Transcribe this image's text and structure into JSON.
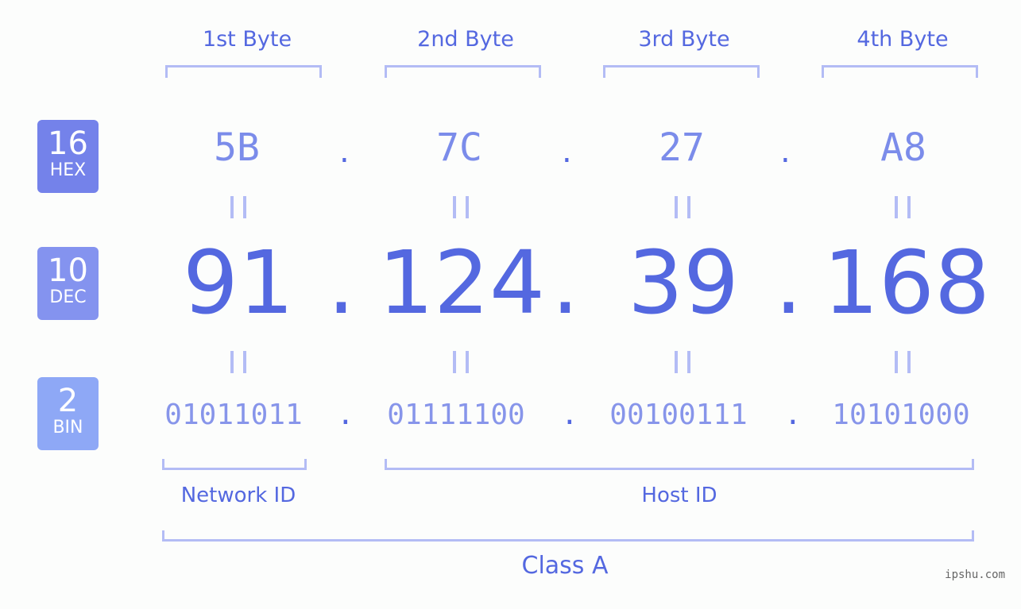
{
  "bytes": [
    {
      "label": "1st Byte",
      "hex": "5B",
      "dec": "91",
      "bin": "01011011"
    },
    {
      "label": "2nd Byte",
      "hex": "7C",
      "dec": "124",
      "bin": "01111100"
    },
    {
      "label": "3rd Byte",
      "hex": "27",
      "dec": "39",
      "bin": "00100111"
    },
    {
      "label": "4th Byte",
      "hex": "A8",
      "dec": "168",
      "bin": "10101000"
    }
  ],
  "separator": ".",
  "badges": {
    "hex": {
      "num": "16",
      "label": "HEX",
      "color": "#7482ea"
    },
    "dec": {
      "num": "10",
      "label": "DEC",
      "color": "#8493ef"
    },
    "bin": {
      "num": "2",
      "label": "BIN",
      "color": "#8ea8f6"
    }
  },
  "segments": {
    "network": "Network ID",
    "host": "Host ID",
    "class": "Class A"
  },
  "watermark": "ipshu.com"
}
